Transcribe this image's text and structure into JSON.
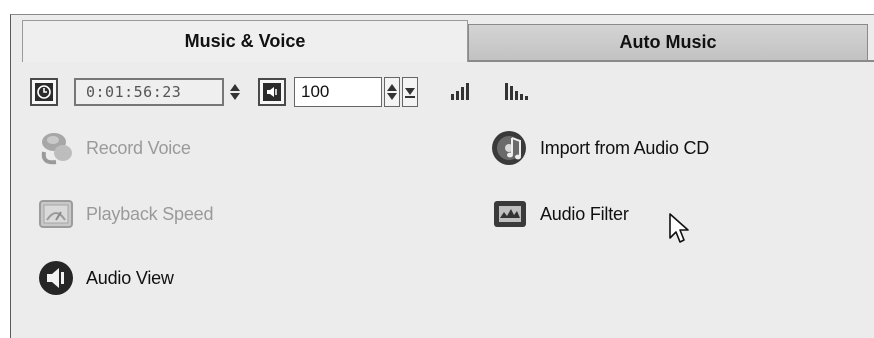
{
  "tabs": [
    {
      "label": "Music & Voice",
      "active": true
    },
    {
      "label": "Auto Music",
      "active": false
    }
  ],
  "toolbar": {
    "timecode": "0:01:56:23",
    "volume": "100",
    "icons": [
      "clock-icon",
      "speaker-mute-icon",
      "volume-bars-icon",
      "waveform-bars-icon"
    ]
  },
  "actions": {
    "record_voice": {
      "label": "Record Voice",
      "enabled": false,
      "icon": "microphone-icon"
    },
    "playback_speed": {
      "label": "Playback Speed",
      "enabled": false,
      "icon": "speedometer-icon"
    },
    "audio_view": {
      "label": "Audio View",
      "enabled": true,
      "icon": "speaker-icon"
    },
    "import_cd": {
      "label": "Import from Audio CD",
      "enabled": true,
      "icon": "cd-music-icon"
    },
    "audio_filter": {
      "label": "Audio Filter",
      "enabled": true,
      "icon": "audio-filter-icon"
    }
  },
  "colors": {
    "panel_bg": "#ececec",
    "disabled_text": "#9a9a9a",
    "enabled_text": "#111111"
  }
}
